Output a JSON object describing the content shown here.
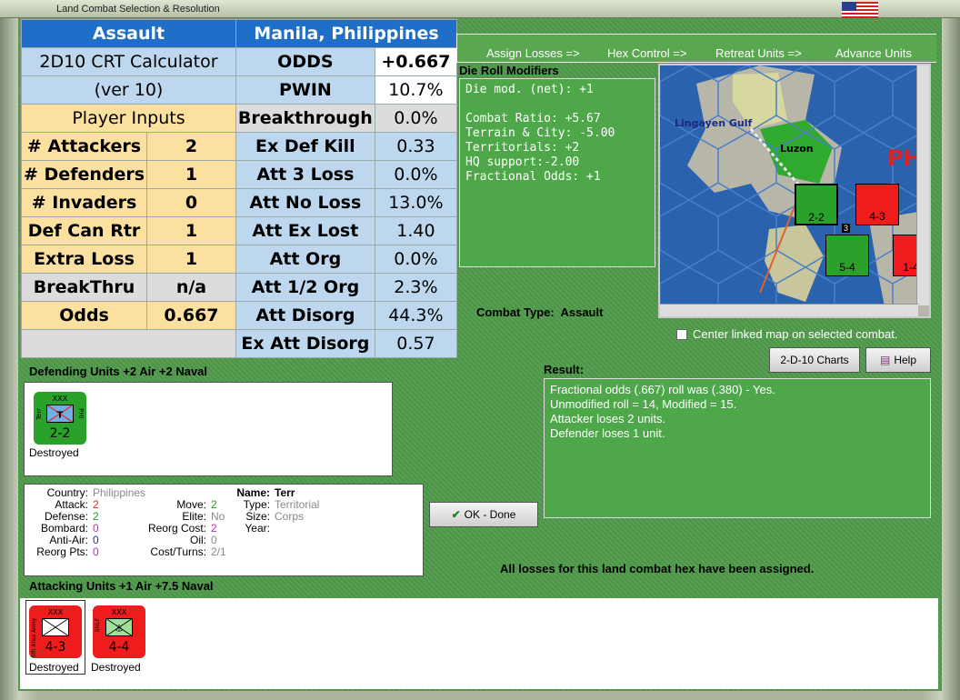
{
  "window": {
    "title": "Land Combat Selection & Resolution"
  },
  "calculator": {
    "header_left": "Assault",
    "header_right": "Manila, Philippines",
    "title1": "2D10 CRT Calculator",
    "title2": "(ver 10)",
    "player_inputs": "Player Inputs",
    "inputs": [
      {
        "label": "# Attackers",
        "value": "2"
      },
      {
        "label": "# Defenders",
        "value": "1"
      },
      {
        "label": "# Invaders",
        "value": "0"
      },
      {
        "label": "Def Can Rtr",
        "value": "1"
      },
      {
        "label": "Extra Loss",
        "value": "1"
      },
      {
        "label": "BreakThru",
        "value": "n/a"
      },
      {
        "label": "Odds",
        "value": "0.667"
      }
    ],
    "results": [
      {
        "label": "ODDS",
        "value": "+0.667"
      },
      {
        "label": "PWIN",
        "value": "10.7%"
      },
      {
        "label": "Breakthrough",
        "value": "0.0%"
      },
      {
        "label": "Ex Def Kill",
        "value": "0.33"
      },
      {
        "label": "Att 3 Loss",
        "value": "0.0%"
      },
      {
        "label": "Att No Loss",
        "value": "13.0%"
      },
      {
        "label": "Att Ex Lost",
        "value": "1.40"
      },
      {
        "label": "Att Org",
        "value": "0.0%"
      },
      {
        "label": "Att 1/2 Org",
        "value": "2.3%"
      },
      {
        "label": "Att Disorg",
        "value": "44.3%"
      },
      {
        "label": "Ex Att Disorg",
        "value": "0.57"
      }
    ]
  },
  "toolbar": {
    "assign_losses": "Assign Losses =>",
    "hex_control": "Hex Control =>",
    "retreat_units": "Retreat Units =>",
    "advance_units": "Advance Units"
  },
  "die_roll": {
    "label": "Die Roll Modifiers",
    "lines": [
      "Die mod. (net): +1",
      "",
      "Combat Ratio: +5.67",
      "Terrain & City: -5.00",
      "Territorials: +2",
      "HQ support:-2.00",
      "Fractional Odds: +1"
    ]
  },
  "map": {
    "label_gulf": "Lingayen Gulf",
    "label_luzon": "Luzon",
    "label_ph": "PH",
    "unit1": "2-2",
    "unit2": "4-3",
    "unit3": "5-4",
    "unit4": "1-4",
    "stack3": "3"
  },
  "combat_type": {
    "label": "Combat Type:",
    "value": "Assault"
  },
  "center_map": "Center linked map on selected combat.",
  "buttons": {
    "charts": "2-D-10 Charts",
    "help": "Help",
    "ok": "OK - Done"
  },
  "defending": {
    "label": "Defending Units +2 Air +2 Naval",
    "units": [
      {
        "strength": "2-2",
        "top": "XXX",
        "side_left": "Terr",
        "side_right": "PHI",
        "status": "Destroyed"
      }
    ]
  },
  "result": {
    "label": "Result:",
    "lines": [
      "Fractional odds (.667) roll was (.380)  - Yes.",
      "Unmodified roll = 14, Modified = 15.",
      "Attacker loses 2 units.",
      "Defender loses 1 unit."
    ]
  },
  "unit_info": {
    "country_label": "Country:",
    "country": "Philippines",
    "attack_label": "Attack:",
    "attack": "2",
    "defense_label": "Defense:",
    "defense": "2",
    "bombard_label": "Bombard:",
    "bombard": "0",
    "antiair_label": "Anti-Air:",
    "antiair": "0",
    "reorg_label": "Reorg Pts:",
    "reorg": "0",
    "move_label": "Move:",
    "move": "2",
    "elite_label": "Elite:",
    "elite": "No",
    "reorgcost_label": "Reorg Cost:",
    "reorgcost": "2",
    "oil_label": "Oil:",
    "oil": "0",
    "cost_label": "Cost/Turns:",
    "cost": "2/1",
    "name_label": "Name:",
    "name": "Terr",
    "type_label": "Type:",
    "type": "Territorial",
    "size_label": "Size:",
    "size": "Corps",
    "year_label": "Year:",
    "year": ""
  },
  "losses_msg": "All losses for this land combat hex have been assigned.",
  "attacking": {
    "label": "Attacking Units +1 Air +7.5 Naval",
    "units": [
      {
        "strength": "4-3",
        "top": "XXX",
        "side_left": "Sth Area Army",
        "status": "Destroyed"
      },
      {
        "strength": "4-4",
        "top": "XXX",
        "side_left": "SNLF",
        "status": "Destroyed"
      }
    ]
  },
  "colors": {
    "green_unit": "#2aa12a",
    "red_unit": "#ee1c1c",
    "calc_blue": "#1f6fc9"
  }
}
